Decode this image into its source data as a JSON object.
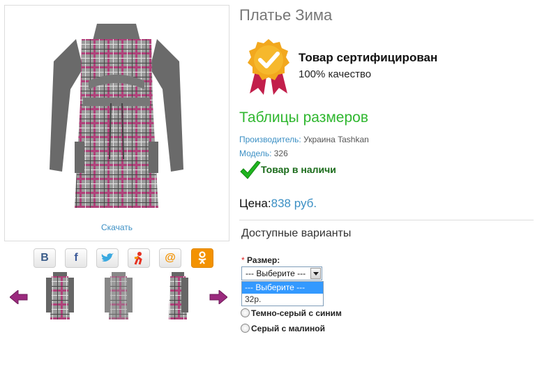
{
  "product": {
    "title": "Платье Зима",
    "download_label": "Скачать"
  },
  "certificate": {
    "title": "Товар сертифицирован",
    "subtitle": "100% качество"
  },
  "size_table_link": "Таблицы размеров",
  "manufacturer": {
    "label": "Производитель:",
    "value": "Украина Tashkan"
  },
  "model": {
    "label": "Модель:",
    "value": "326"
  },
  "stock": "Товар в наличи",
  "price": {
    "label": "Цена:",
    "value": "838 руб."
  },
  "variants": {
    "title": "Доступные варианты",
    "size_label": "Размер:",
    "required_mark": "*",
    "select_value": "--- Выберите ---",
    "options": [
      "--- Выберите ---",
      "32р."
    ],
    "colors": [
      "Темно-серый с синим",
      "Серый с малиной"
    ]
  },
  "share": {
    "icons": [
      "vk-icon",
      "facebook-icon",
      "twitter-icon",
      "moimir-icon",
      "mail-icon",
      "odnoklassniki-icon"
    ],
    "vk_glyph": "B",
    "fb_glyph": "f",
    "mail_glyph": "@"
  },
  "colors": {
    "link_blue": "#3b8fc4",
    "green": "#2fb72f",
    "arrow": "#9b2a7e",
    "ok_orange": "#f39200"
  }
}
